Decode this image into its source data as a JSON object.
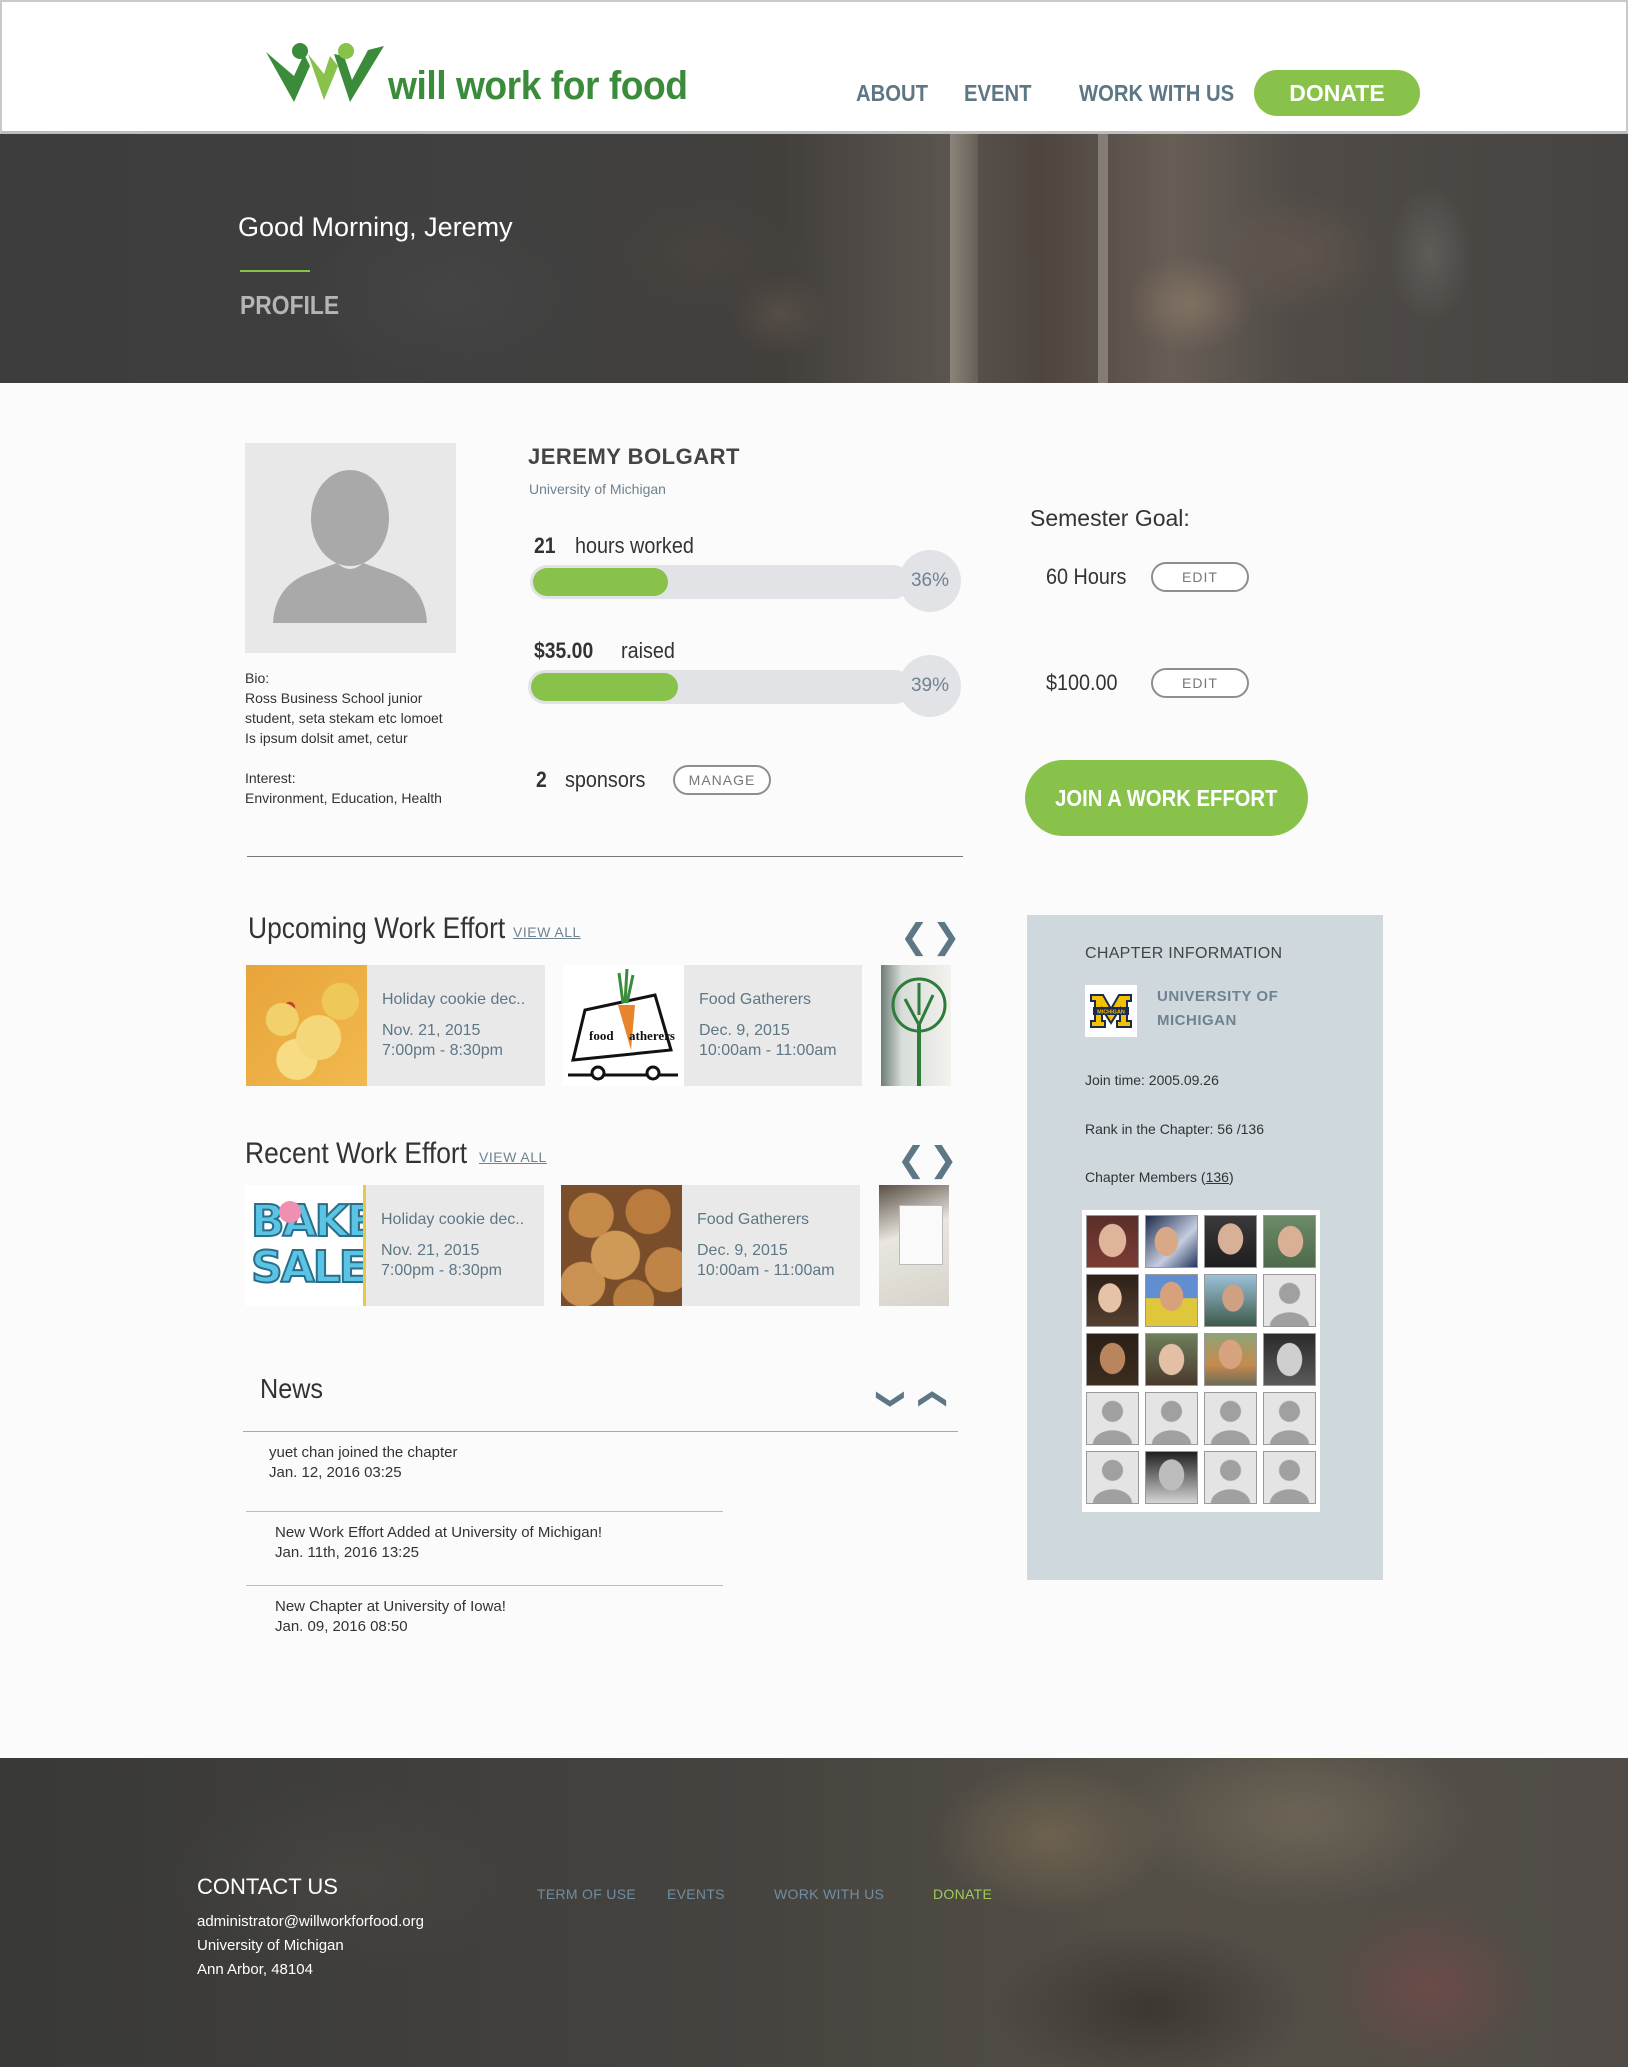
{
  "header": {
    "logo_text": "will work for food",
    "nav": [
      "ABOUT",
      "EVENT",
      "WORK WITH US"
    ],
    "donate": "DONATE"
  },
  "hero": {
    "greeting": "Good Morning, Jeremy",
    "section": "PROFILE"
  },
  "profile": {
    "name": "JEREMY BOLGART",
    "school": "University of Michigan",
    "bio_label": "Bio:",
    "bio_lines": [
      "Ross Business School junior",
      "student, seta stekam etc lomoet",
      "Is ipsum dolsit amet, cetur"
    ],
    "interest_label": "Interest:",
    "interest": "Environment, Education, Health",
    "hours_value": "21",
    "hours_label": "hours worked",
    "hours_pct": "36%",
    "hours_fraction": 0.36,
    "raised_value": "$35.00",
    "raised_label": "raised",
    "raised_pct": "39%",
    "raised_fraction": 0.39,
    "sponsors_value": "2",
    "sponsors_label": "sponsors",
    "manage": "MANAGE"
  },
  "goal": {
    "title": "Semester Goal:",
    "hours": "60 Hours",
    "amount": "$100.00",
    "edit": "EDIT",
    "join": "JOIN A WORK EFFORT"
  },
  "upcoming": {
    "title": "Upcoming Work Effort",
    "view_all": "VIEW ALL",
    "cards": [
      {
        "title": "Holiday cookie dec..",
        "date": "Nov. 21, 2015",
        "time": "7:00pm - 8:30pm"
      },
      {
        "title": "Food Gatherers",
        "date": "Dec. 9, 2015",
        "time": "10:00am - 11:00am"
      }
    ]
  },
  "recent": {
    "title": "Recent Work Effort",
    "view_all": "VIEW ALL",
    "cards": [
      {
        "title": "Holiday cookie dec..",
        "date": "Nov. 21, 2015",
        "time": "7:00pm - 8:30pm"
      },
      {
        "title": "Food Gatherers",
        "date": "Dec. 9, 2015",
        "time": "10:00am - 11:00am"
      }
    ],
    "bake_sale_line1": "BAKE",
    "bake_sale_line2": "SALE"
  },
  "news": {
    "title": "News",
    "items": [
      {
        "text": "yuet chan joined the chapter",
        "time": "Jan. 12, 2016  03:25"
      },
      {
        "text": "New Work Effort Added at University of Michigan!",
        "time": "Jan. 11th, 2016  13:25"
      },
      {
        "text": "New Chapter at University of Iowa!",
        "time": "Jan. 09, 2016  08:50"
      }
    ]
  },
  "chapter": {
    "heading": "CHAPTER INFORMATION",
    "uni_line1": "UNIVERSITY OF",
    "uni_line2": "MICHIGAN",
    "logo_text": "MICHIGAN",
    "join_time": "Join time: 2005.09.26",
    "rank": "Rank  in the Chapter: 56 /136",
    "members_label": "Chapter Members (",
    "members_count": "136",
    "members_close": ")"
  },
  "footer": {
    "contact_title": "CONTACT US",
    "email": "administrator@willworkforfood.org",
    "org": "University of Michigan",
    "city": "Ann Arbor, 48104",
    "links": [
      "TERM OF USE",
      "EVENTS",
      "WORK WITH US",
      "DONATE"
    ]
  },
  "colors": {
    "brand_green": "#88c24a",
    "logo_green": "#3a8c3a",
    "slate": "#5e7785",
    "panel": "#cfd8dd"
  }
}
